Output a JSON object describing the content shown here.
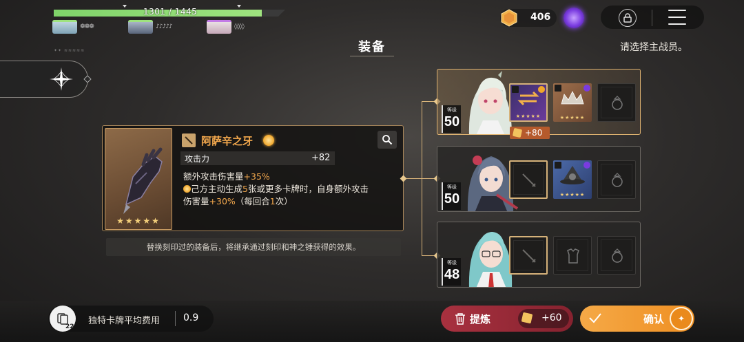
{
  "hud": {
    "hp_text": "1301 / 1445",
    "hp_fraction": 0.9,
    "currency_value": "406"
  },
  "page": {
    "title": "装备",
    "hint": "请选择主战员。",
    "tiny_label": "✦✦ ≋≋≋≋≋"
  },
  "item": {
    "name": "阿萨辛之牙",
    "stars": "★★★★★",
    "stat_label": "攻击力",
    "stat_value": "+82",
    "desc_line1_prefix": "额外攻击伤害量",
    "desc_line1_value": "+35%",
    "desc_line2_prefix": "己方主动生成",
    "desc_line2_count": "5",
    "desc_line2_suffix": "张或更多卡牌时，自身额外攻击",
    "desc_line3_prefix": "伤害量",
    "desc_line3_value": "+30%",
    "desc_line3_mid": "（每回合",
    "desc_line3_count": "1",
    "desc_line3_suffix": "次）",
    "notice": "替换刻印过的装备后，将继承通过刻印和神之锤获得的效果。"
  },
  "characters": [
    {
      "level_tag": "等级",
      "level": "50",
      "slot1_stars": "★★★★★",
      "slot2_stars": "★★★★★",
      "plus_value": "+80"
    },
    {
      "level_tag": "等级",
      "level": "50",
      "slot2_stars": "★★★★★"
    },
    {
      "level_tag": "等级",
      "level": "48"
    }
  ],
  "bottom": {
    "deck_count": "22",
    "deck_label": "独特卡牌平均费用",
    "deck_value": "0.9",
    "refine_label": "提炼",
    "refine_cost": "+60",
    "confirm_label": "确认"
  },
  "colors": {
    "accent_orange": "#f3a84d",
    "hp_green": "#8fdb74",
    "refine_red": "#a8313f",
    "confirm_orange": "#f5a947"
  }
}
